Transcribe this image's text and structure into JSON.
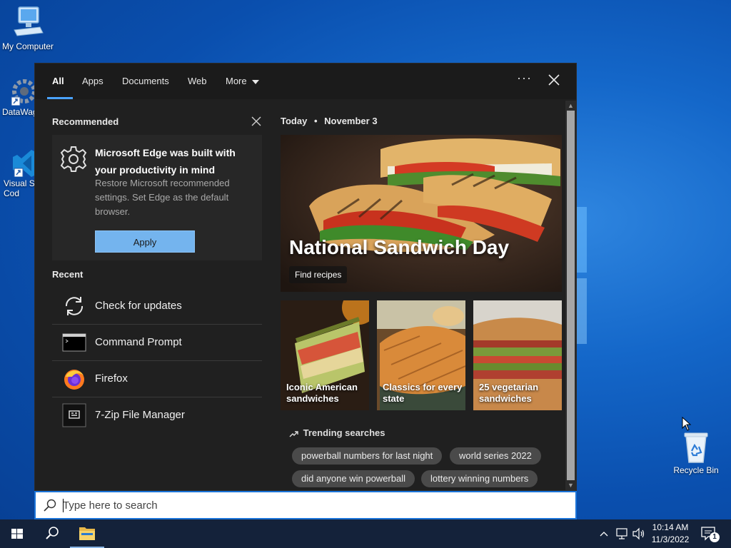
{
  "desktop": {
    "icons": [
      {
        "label": "My Computer"
      },
      {
        "label": "DataWag"
      },
      {
        "label": "Visual St Cod"
      },
      {
        "label": "Recycle Bin"
      }
    ]
  },
  "search_panel": {
    "tabs": [
      {
        "label": "All",
        "active": true
      },
      {
        "label": "Apps"
      },
      {
        "label": "Documents"
      },
      {
        "label": "Web"
      },
      {
        "label": "More"
      }
    ],
    "more_options_label": "···",
    "recommended": {
      "title": "Recommended",
      "card_title": "Microsoft Edge was built with your productivity in mind",
      "card_body": "Restore Microsoft recommended settings. Set Edge as the default browser.",
      "button_label": "Apply"
    },
    "recent": {
      "title": "Recent",
      "items": [
        {
          "label": "Check for updates",
          "icon": "refresh-icon"
        },
        {
          "label": "Command Prompt",
          "icon": "terminal-icon"
        },
        {
          "label": "Firefox",
          "icon": "firefox-icon"
        },
        {
          "label": "7-Zip File Manager",
          "icon": "archive-icon"
        }
      ]
    },
    "today": {
      "label": "Today",
      "separator": "•",
      "date": "November 3"
    },
    "hero": {
      "title": "National Sandwich Day",
      "link_label": "Find recipes"
    },
    "tiles": [
      {
        "label": "Iconic American sandwiches"
      },
      {
        "label": "Classics for every state"
      },
      {
        "label": "25 vegetarian sandwiches"
      }
    ],
    "trending": {
      "title": "Trending searches",
      "chips": [
        "powerball numbers for last night",
        "world series 2022",
        "did anyone win powerball",
        "lottery winning numbers"
      ]
    }
  },
  "searchbox": {
    "placeholder": "Type here to search"
  },
  "taskbar": {
    "time": "10:14 AM",
    "date": "11/3/2022",
    "notification_count": "1"
  },
  "colors": {
    "accent": "#4aa3ff",
    "apply_button": "#74b4ee",
    "panel_bg": "#202020",
    "taskbar_bg": "#14223a"
  }
}
